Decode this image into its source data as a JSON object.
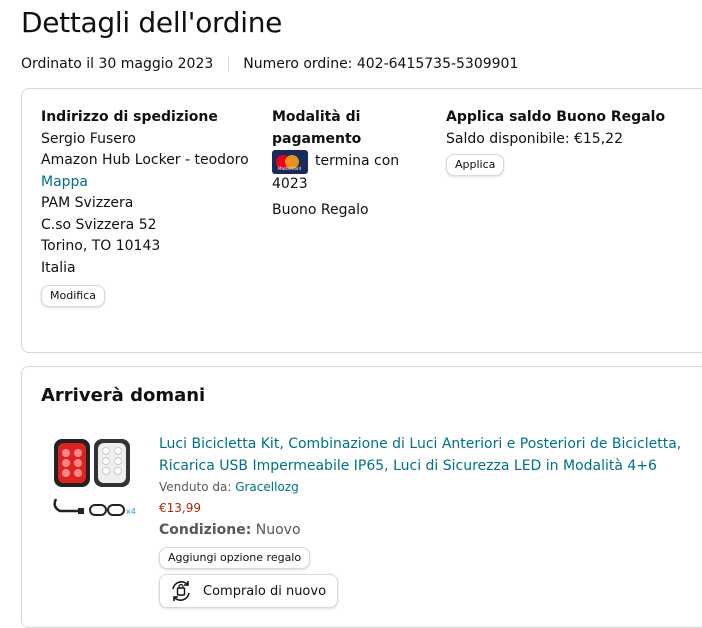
{
  "page": {
    "title": "Dettagli dell'ordine",
    "order_date": "Ordinato il 30 maggio 2023",
    "order_number": "Numero ordine: 402-6415735-5309901"
  },
  "shipping": {
    "heading": "Indirizzo di spedizione",
    "name": "Sergio Fusero",
    "line1": "Amazon Hub Locker - teodoro",
    "map_link": "Mappa",
    "line2": "PAM Svizzera",
    "line3": "C.so Svizzera 52",
    "line4": "Torino, TO 10143",
    "country": "Italia",
    "edit_button": "Modifica"
  },
  "payment": {
    "heading_line1": "Modalità di",
    "heading_line2": "pagamento",
    "card_text": "termina con",
    "card_digits": "4023",
    "gift_card": "Buono Regalo",
    "card_brand_icon": "mastercard-icon",
    "card_icon_text": "MasterCard"
  },
  "gift_balance": {
    "heading": "Applica saldo Buono Regalo",
    "balance": "Saldo disponibile: €15,22",
    "apply_button": "Applica"
  },
  "delivery": {
    "heading": "Arriverà domani",
    "product_title_line1": "Luci Bicicletta Kit, Combinazione di Luci Anteriori e Posteriori de Bicicletta,",
    "product_title_line2": "Ricarica USB Impermeabile IP65, Luci di Sicurezza LED in Modalità 4+6",
    "sold_by_label": "Venduto da:",
    "seller": "Gracellozg",
    "price": "€13,99",
    "condition_label": "Condizione:",
    "condition_value": "Nuovo",
    "gift_option_button": "Aggiungi opzione regalo",
    "buy_again_button": "Compralo di nuovo",
    "image_label": "x4"
  },
  "colors": {
    "link": "#007185",
    "price": "#B12704",
    "border": "#D5D9D9"
  }
}
